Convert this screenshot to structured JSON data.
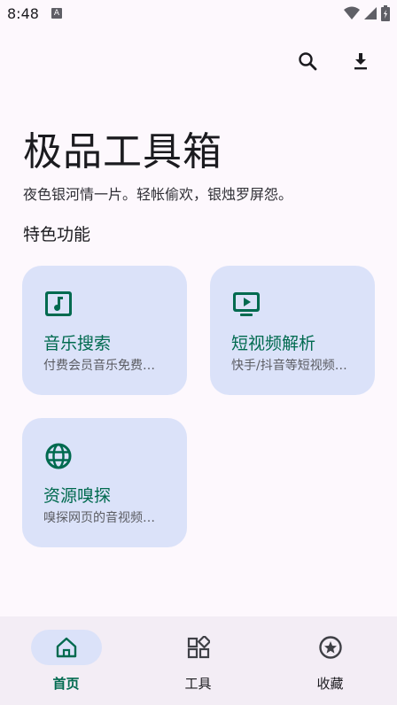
{
  "status_bar": {
    "time": "8:48",
    "notif_letter": "A"
  },
  "toolbar": {
    "search_icon": "search-icon",
    "download_icon": "download-icon"
  },
  "header": {
    "title": "极品工具箱",
    "subtitle": "夜色银河情一片。轻帐偷欢，银烛罗屏怨。"
  },
  "section": {
    "title": "特色功能"
  },
  "cards": [
    {
      "title": "音乐搜索",
      "desc": "付费会员音乐免费…",
      "icon": "music-note-icon"
    },
    {
      "title": "短视频解析",
      "desc": "快手/抖音等短视频…",
      "icon": "video-play-icon"
    },
    {
      "title": "资源嗅探",
      "desc": "嗅探网页的音视频…",
      "icon": "globe-icon"
    }
  ],
  "nav": [
    {
      "label": "首页",
      "icon": "home-icon",
      "active": true
    },
    {
      "label": "工具",
      "icon": "widgets-icon",
      "active": false
    },
    {
      "label": "收藏",
      "icon": "star-icon",
      "active": false
    }
  ],
  "colors": {
    "accent": "#006a4f",
    "card_bg": "#dbe2f9",
    "background": "#fdf8fd",
    "nav_bg": "#f3edf5"
  }
}
